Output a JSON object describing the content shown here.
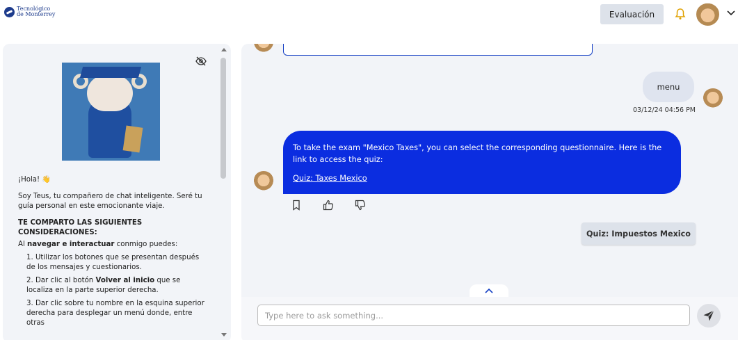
{
  "header": {
    "logo_line1": "Tecnológico",
    "logo_line2": "de Monterrey",
    "eval_button": "Evaluación",
    "bell_icon": "bell-icon",
    "user_menu_icon": "chevron-down-icon"
  },
  "sidebar": {
    "greeting": "¡Hola! 👋",
    "intro": "Soy Teus, tu compañero de chat inteligente. Seré tu guía personal en este emocionante viaje.",
    "heading": "TE COMPARTO LAS SIGUIENTES CONSIDERACIONES:",
    "lead_prefix": "Al ",
    "lead_bold1": "navegar e interactuar",
    "lead_suffix": " conmigo puedes:",
    "item1": "1. Utilizar los botones que se presentan después de los mensajes y cuestionarios.",
    "item2_prefix": "2. Dar clic al botón ",
    "item2_bold": "Volver al inicio",
    "item2_suffix": " que se localiza en la parte superior derecha.",
    "item3": "3. Dar clic sobre tu nombre en la esquina superior derecha para desplegar un menú donde, entre otras"
  },
  "chat": {
    "user_message": "menu",
    "timestamp": "03/12/24 04:56 PM",
    "bot_message": "To take the exam \"Mexico Taxes\", you can select the corresponding questionnaire. Here is the link to access the quiz:",
    "bot_link": "Quiz: Taxes Mexico",
    "quick_reply": "Quiz: Impuestos Mexico",
    "input_placeholder": "Type here to ask something..."
  },
  "colors": {
    "accent": "#0b2de0",
    "panel": "#f2f4f8",
    "button": "#dde2ea"
  }
}
